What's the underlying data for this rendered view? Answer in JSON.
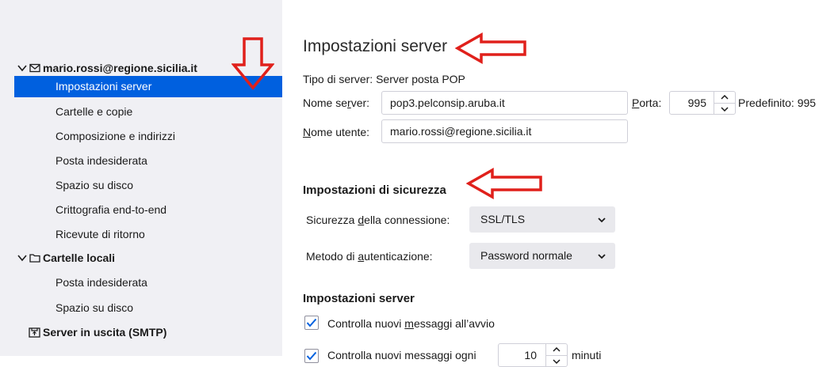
{
  "sidebar": {
    "account": "mario.rossi@regione.sicilia.it",
    "account_items": [
      "Impostazioni server",
      "Cartelle e copie",
      "Composizione e indirizzi",
      "Posta indesiderata",
      "Spazio su disco",
      "Crittografia end-to-end",
      "Ricevute di ritorno"
    ],
    "local": "Cartelle locali",
    "local_items": [
      "Posta indesiderata",
      "Spazio su disco"
    ],
    "smtp": "Server in uscita (SMTP)"
  },
  "main": {
    "title": "Impostazioni server",
    "server_type": "Tipo di server: Server posta POP",
    "server_name_label": "Nome server:",
    "server_name_value": "pop3.pelconsip.aruba.it",
    "port_label": "Porta:",
    "port_value": "995",
    "default_label": "Predefinito: 995",
    "username_label": "Nome utente:",
    "username_value": "mario.rossi@regione.sicilia.it",
    "security_heading": "Impostazioni di sicurezza",
    "conn_security_label": "Sicurezza della connessione:",
    "conn_security_value": "SSL/TLS",
    "auth_label": "Metodo di autenticazione:",
    "auth_value": "Password normale",
    "server_settings_heading": "Impostazioni server",
    "check_startup_label": "Controlla nuovi messaggi all'avvio",
    "check_every_label": "Controlla nuovi messaggi ogni",
    "check_every_value": "10",
    "minutes_label": "minuti"
  },
  "colors": {
    "selected": "#0060df",
    "annotation_arrow": "#e0201b",
    "sidebar_bg": "#f0f0f4"
  }
}
